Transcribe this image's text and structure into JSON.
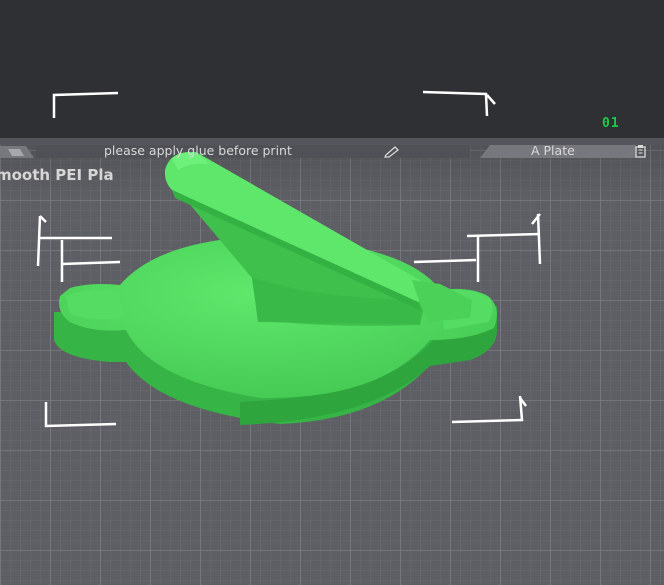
{
  "viewport": {
    "background": "#2f3033",
    "plate_color": "#5e5f64",
    "model_color": "#4cd95a"
  },
  "plate": {
    "number": "01",
    "note": "please apply glue before print",
    "name": "A Plate",
    "type_label": "mooth PEI Pla",
    "note_edit_icon": "pencil-icon",
    "settings_icon": "plate-settings-icon"
  },
  "model": {
    "name": "3d-model"
  }
}
